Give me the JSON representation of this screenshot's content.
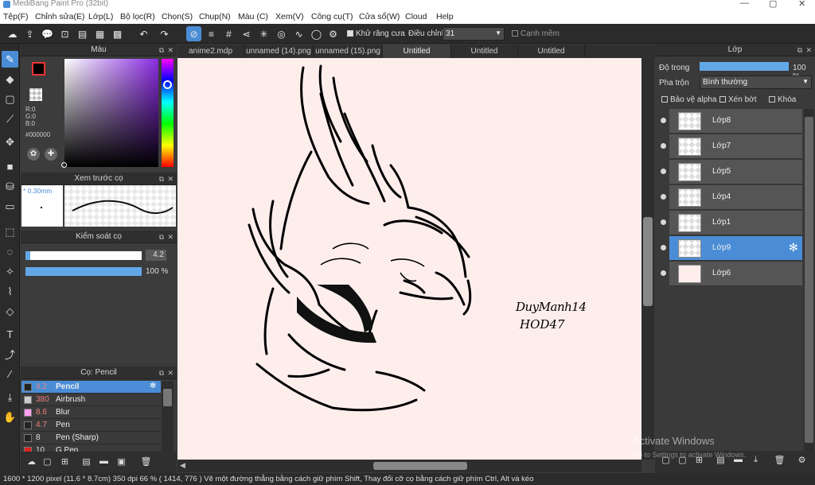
{
  "window": {
    "title": "MediBang Paint Pro (32bit)",
    "min": "—",
    "max": "▢",
    "close": "✕"
  },
  "menu": [
    "Tệp(F)",
    "Chỉnh sửa(E)",
    "Lớp(L)",
    "Bộ lọc(R)",
    "Chọn(S)",
    "Chụp(N)",
    "Màu (C)",
    "Xem(V)",
    "Công cụ(T)",
    "Cửa sổ(W)",
    "Cloud",
    "Help"
  ],
  "toolbar": {
    "antialias_label": "Khử răng cưa",
    "adjust_label": "Điều chỉnh",
    "adjust_value": "31",
    "smooth_label": "Cạnh mềm"
  },
  "color_panel": {
    "title": "Màu",
    "r": "R:0",
    "g": "G:0",
    "b": "B:0",
    "hex": "#000000",
    "hue_accent": "#8a2be2"
  },
  "brush_preview": {
    "title": "Xem trước cọ",
    "size": "* 0.30mm"
  },
  "brush_control": {
    "title": "Kiểm soát cọ",
    "size_value": "4.2",
    "opacity_value": "100 %",
    "size_fraction": 0.04,
    "opacity_fraction": 1.0
  },
  "brush_panel": {
    "title": "Cọ: Pencil",
    "items": [
      {
        "size": "4.2",
        "name": "Pencil",
        "color": "#222222"
      },
      {
        "size": "380",
        "name": "Airbrush",
        "color": "#cccccc"
      },
      {
        "size": "8.6",
        "name": "Blur",
        "color": "#ff9ff0"
      },
      {
        "size": "4.7",
        "name": "Pen",
        "color": "#222222"
      },
      {
        "size": "8",
        "name": "Pen (Sharp)",
        "color": "#222222"
      },
      {
        "size": "10",
        "name": "G Pen",
        "color": "#e02020"
      }
    ]
  },
  "tabs": [
    "anime2.mdp",
    "unnamed (14).png",
    "unnamed (15).png",
    "Untitled",
    "Untitled",
    "Untitled"
  ],
  "layer_panel": {
    "title": "Lớp",
    "opacity_label": "Độ trong",
    "opacity_value": "100 %",
    "blend_label": "Pha trộn",
    "blend_value": "Bình thường",
    "protect_alpha": "Bảo vệ alpha",
    "clipping": "Xén bớt",
    "lock": "Khóa",
    "layers": [
      "Lớp8",
      "Lớp7",
      "Lớp5",
      "Lớp4",
      "Lớp1",
      "Lớp9",
      "Lớp6"
    ]
  },
  "canvas": {
    "signature_line1": "DuyManh14",
    "signature_line2": "HOD47",
    "bg_color": "#fdeeec"
  },
  "watermark": {
    "line1": "Activate Windows",
    "line2": "Go to Settings to activate Windows."
  },
  "status": {
    "text": "1600 * 1200 pixel   (11.6 * 8.7cm)   350 dpi   66 %   ( 1414, 776 )   Vẽ một đường thẳng bằng cách giữ phím Shift, Thay đổi cỡ cọ bằng cách giữ phím Ctrl, Alt và kéo"
  }
}
